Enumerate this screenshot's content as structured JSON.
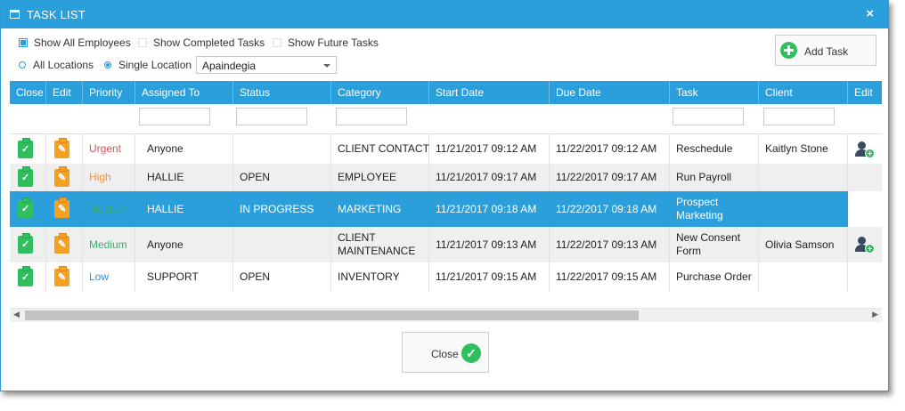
{
  "window": {
    "title": "TASK LIST",
    "close_glyph": "×"
  },
  "options": {
    "show_all_employees": {
      "label": "Show All Employees",
      "checked": true
    },
    "show_completed_tasks": {
      "label": "Show Completed Tasks",
      "checked": false
    },
    "show_future_tasks": {
      "label": "Show Future Tasks",
      "checked": false
    },
    "all_locations": {
      "label": "All Locations",
      "selected": false
    },
    "single_location": {
      "label": "Single Location",
      "selected": true
    },
    "location_select": {
      "value": "Apaindegia"
    }
  },
  "add_task": {
    "label": "Add Task"
  },
  "table": {
    "columns": [
      "Close",
      "Edit",
      "Priority",
      "Assigned To",
      "Status",
      "Category",
      "Start Date",
      "Due Date",
      "Task",
      "Client",
      "Edit"
    ],
    "rows": [
      {
        "priority": "Urgent",
        "priority_class": "urgent",
        "assigned": "Anyone",
        "status": "",
        "category": "CLIENT CONTACT",
        "start": "11/21/2017 09:12 AM",
        "due": "11/22/2017 09:12 AM",
        "task": "Reschedule",
        "client": "Kaitlyn Stone",
        "has_client_edit": true
      },
      {
        "priority": "High",
        "priority_class": "high",
        "assigned": "HALLIE",
        "status": "OPEN",
        "category": "EMPLOYEE",
        "start": "11/21/2017 09:17 AM",
        "due": "11/22/2017 09:17 AM",
        "task": "Run Payroll",
        "client": "",
        "has_client_edit": false
      },
      {
        "priority": "Medium",
        "priority_class": "medium",
        "assigned": "HALLIE",
        "status": "IN PROGRESS",
        "category": "MARKETING",
        "start": "11/21/2017 09:18 AM",
        "due": "11/22/2017 09:18 AM",
        "task": "Prospect Marketing",
        "client": "",
        "has_client_edit": false
      },
      {
        "priority": "Medium",
        "priority_class": "medium",
        "assigned": "Anyone",
        "status": "",
        "category": "CLIENT MAINTENANCE",
        "start": "11/21/2017 09:13 AM",
        "due": "11/22/2017 09:13 AM",
        "task": "New Consent Form",
        "client": "Olivia Samson",
        "has_client_edit": true
      },
      {
        "priority": "Low",
        "priority_class": "low",
        "assigned": "SUPPORT",
        "status": "OPEN",
        "category": "INVENTORY",
        "start": "11/21/2017 09:15 AM",
        "due": "11/22/2017 09:15 AM",
        "task": "Purchase Order",
        "client": "",
        "has_client_edit": false
      }
    ],
    "selected_row": 2
  },
  "close_button": {
    "label": "Close"
  },
  "colors": {
    "accent": "#2a9fdc",
    "success": "#2fbf5f",
    "warning": "#f4a020"
  }
}
